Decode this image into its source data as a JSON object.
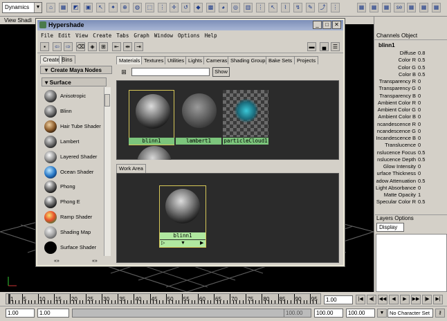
{
  "toolbar": {
    "mode": "Dynamics",
    "right_label": "se"
  },
  "viewport": {
    "menu": "View Shadi"
  },
  "hypershade": {
    "title": "Hypershade",
    "menu": [
      "File",
      "Edit",
      "View",
      "Create",
      "Tabs",
      "Graph",
      "Window",
      "Options",
      "Help"
    ],
    "left_tabs": [
      "Create",
      "Bins"
    ],
    "create_header": "Create Maya Nodes",
    "surface_header": "Surface",
    "shaders": [
      "Anisotropic",
      "Blinn",
      "Hair Tube Shader",
      "Lambert",
      "Layered Shader",
      "Ocean Shader",
      "Phong",
      "Phong E",
      "Ramp Shader",
      "Shading Map",
      "Surface Shader"
    ],
    "left_bottom_left": "«»",
    "left_bottom_right": "«»",
    "right_tabs": [
      "Materials",
      "Textures",
      "Utilities",
      "Lights",
      "Cameras",
      "Shading Groups",
      "Bake Sets",
      "Projects"
    ],
    "show_label": "Show",
    "swatches": [
      "blinn1",
      "lambert1",
      "particleCloud1"
    ],
    "work_area_tab": "Work Area",
    "work_node_label": "blinn1"
  },
  "channel_box": {
    "tabs": "Channels Object",
    "node_name": "blinn1",
    "rows": [
      {
        "name": "Diffuse",
        "value": "0.8"
      },
      {
        "name": "Color R",
        "value": "0.5"
      },
      {
        "name": "Color G",
        "value": "0.5"
      },
      {
        "name": "Color B",
        "value": "0.5"
      },
      {
        "name": "Transparency R",
        "value": "0"
      },
      {
        "name": "Transparency G",
        "value": "0"
      },
      {
        "name": "Transparency B",
        "value": "0"
      },
      {
        "name": "Ambient Color R",
        "value": "0"
      },
      {
        "name": "Ambient Color G",
        "value": "0"
      },
      {
        "name": "Ambient Color B",
        "value": "0"
      },
      {
        "name": "ncandescence R",
        "value": "0"
      },
      {
        "name": "ncandescence G",
        "value": "0"
      },
      {
        "name": "Incandescence B",
        "value": "0"
      },
      {
        "name": "Translucence",
        "value": "0"
      },
      {
        "name": "nslucence Focus",
        "value": "0.5"
      },
      {
        "name": "nslucence Depth",
        "value": "0.5"
      },
      {
        "name": "Glow Intensity",
        "value": "0"
      },
      {
        "name": "urface Thickness",
        "value": "0"
      },
      {
        "name": "adow Attenuation",
        "value": "0.5"
      },
      {
        "name": "Light Absorbance",
        "value": "0"
      },
      {
        "name": "Matte Opacity",
        "value": "1"
      },
      {
        "name": "Specular Color R",
        "value": "0.5"
      }
    ],
    "layers_header": "Layers Options",
    "layers_display": "Display"
  },
  "timeline": {
    "ticks": [
      "1",
      "5",
      "10",
      "15",
      "20",
      "25",
      "30",
      "35",
      "40",
      "45",
      "50",
      "55",
      "60",
      "65",
      "70",
      "75",
      "80",
      "85",
      "90",
      "95"
    ],
    "current_frame": "1.00"
  },
  "range": {
    "start": "1.00",
    "inner_start": "1.00",
    "inner_end": "100.00",
    "end": "100.00",
    "end2": "100.00",
    "character_set": "No Character Set"
  }
}
